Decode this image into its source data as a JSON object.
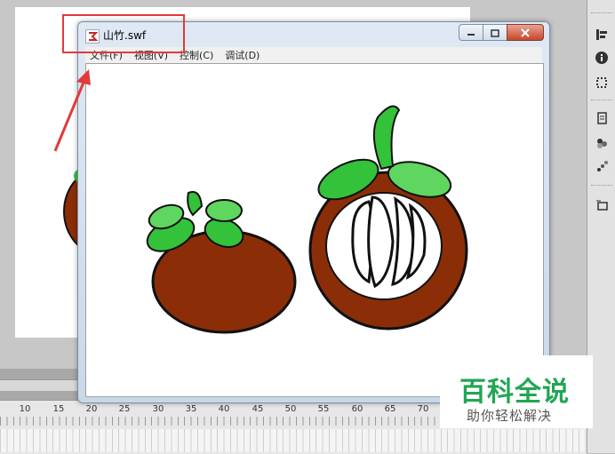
{
  "window": {
    "title": "山竹.swf",
    "menu": [
      "文件(F)",
      "视图(V)",
      "控制(C)",
      "调试(D)"
    ],
    "minimize_icon": "minimize-icon",
    "restore_icon": "restore-icon",
    "close_icon": "close-icon"
  },
  "ruler": {
    "labels": [
      "10",
      "15",
      "20",
      "25",
      "30",
      "35",
      "40",
      "45",
      "50",
      "55",
      "60",
      "65",
      "70"
    ]
  },
  "toolbar": {
    "icons": [
      "panel-icon",
      "align-icon",
      "info-icon",
      "transform-icon",
      "library-icon",
      "components-icon",
      "motion-icon",
      "scene-icon"
    ]
  },
  "watermark": {
    "title": "百科全说",
    "subtitle": "助你轻松解决"
  },
  "colors": {
    "highlight": "#e23a3a",
    "mangosteen_skin": "#8b2e07",
    "leaf_green": "#33c23a",
    "watermark_green": "#22a654"
  }
}
